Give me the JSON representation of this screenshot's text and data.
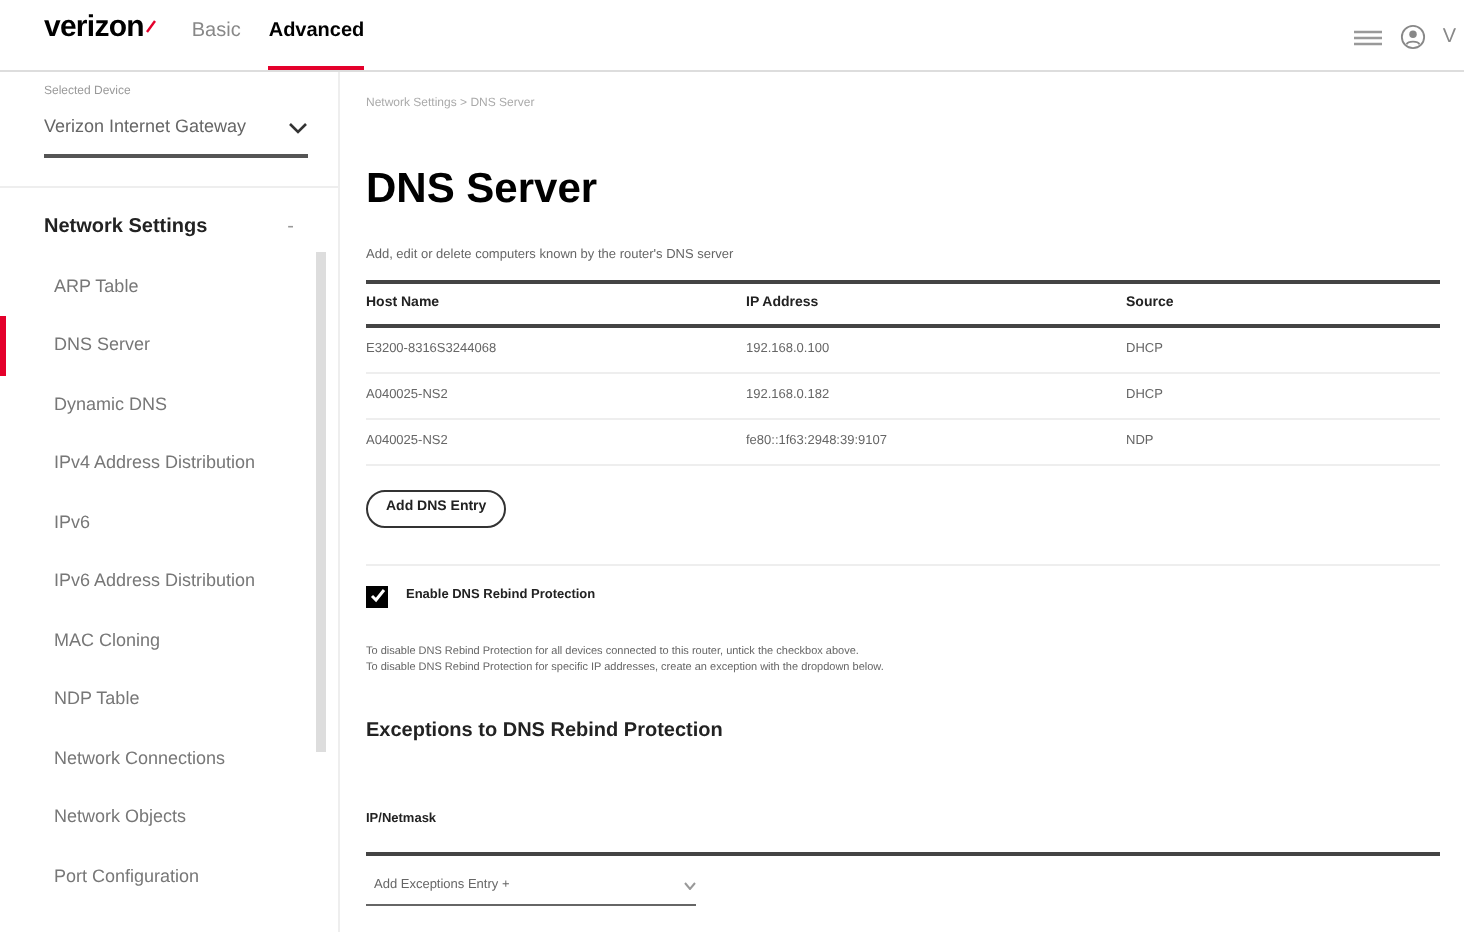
{
  "header": {
    "logo": "verizon",
    "tabs": [
      {
        "label": "Basic",
        "selected": false
      },
      {
        "label": "Advanced",
        "selected": true
      }
    ],
    "user_initial": "V"
  },
  "sidebar": {
    "device_label": "Selected Device",
    "device_select": "Verizon Internet Gateway",
    "section": {
      "title": "Network Settings",
      "expanded": true,
      "toggle": "-"
    },
    "items": [
      {
        "label": "ARP Table",
        "selected": false
      },
      {
        "label": "DNS Server",
        "selected": true
      },
      {
        "label": "Dynamic DNS",
        "selected": false
      },
      {
        "label": "IPv4 Address Distribution",
        "selected": false
      },
      {
        "label": "IPv6",
        "selected": false
      },
      {
        "label": "IPv6 Address Distribution",
        "selected": false
      },
      {
        "label": "MAC Cloning",
        "selected": false
      },
      {
        "label": "NDP Table",
        "selected": false
      },
      {
        "label": "Network Connections",
        "selected": false
      },
      {
        "label": "Network Objects",
        "selected": false
      },
      {
        "label": "Port Configuration",
        "selected": false
      }
    ]
  },
  "breadcrumb": "Network Settings > DNS Server",
  "title": "DNS Server",
  "description": "Add, edit or delete computers known by the router's DNS server",
  "table": {
    "columns": [
      "Host Name",
      "IP Address",
      "Source"
    ],
    "rows": [
      [
        "E3200-8316S3244068",
        "192.168.0.100",
        "DHCP"
      ],
      [
        "A040025-NS2",
        "192.168.0.182",
        "DHCP"
      ],
      [
        "A040025-NS2",
        "fe80::1f63:2948:39:9107",
        "NDP"
      ]
    ]
  },
  "add_button": "Add DNS Entry",
  "rebind": {
    "label": "Enable DNS Rebind Protection",
    "checked": true
  },
  "notes": [
    "To disable DNS Rebind Protection for all devices connected to this router, untick the checkbox above.",
    "To disable DNS Rebind Protection for specific IP addresses, create an exception with the dropdown below."
  ],
  "exceptions": {
    "title": "Exceptions to DNS Rebind Protection",
    "column": "IP/Netmask",
    "dropdown": "Add Exceptions Entry +"
  }
}
